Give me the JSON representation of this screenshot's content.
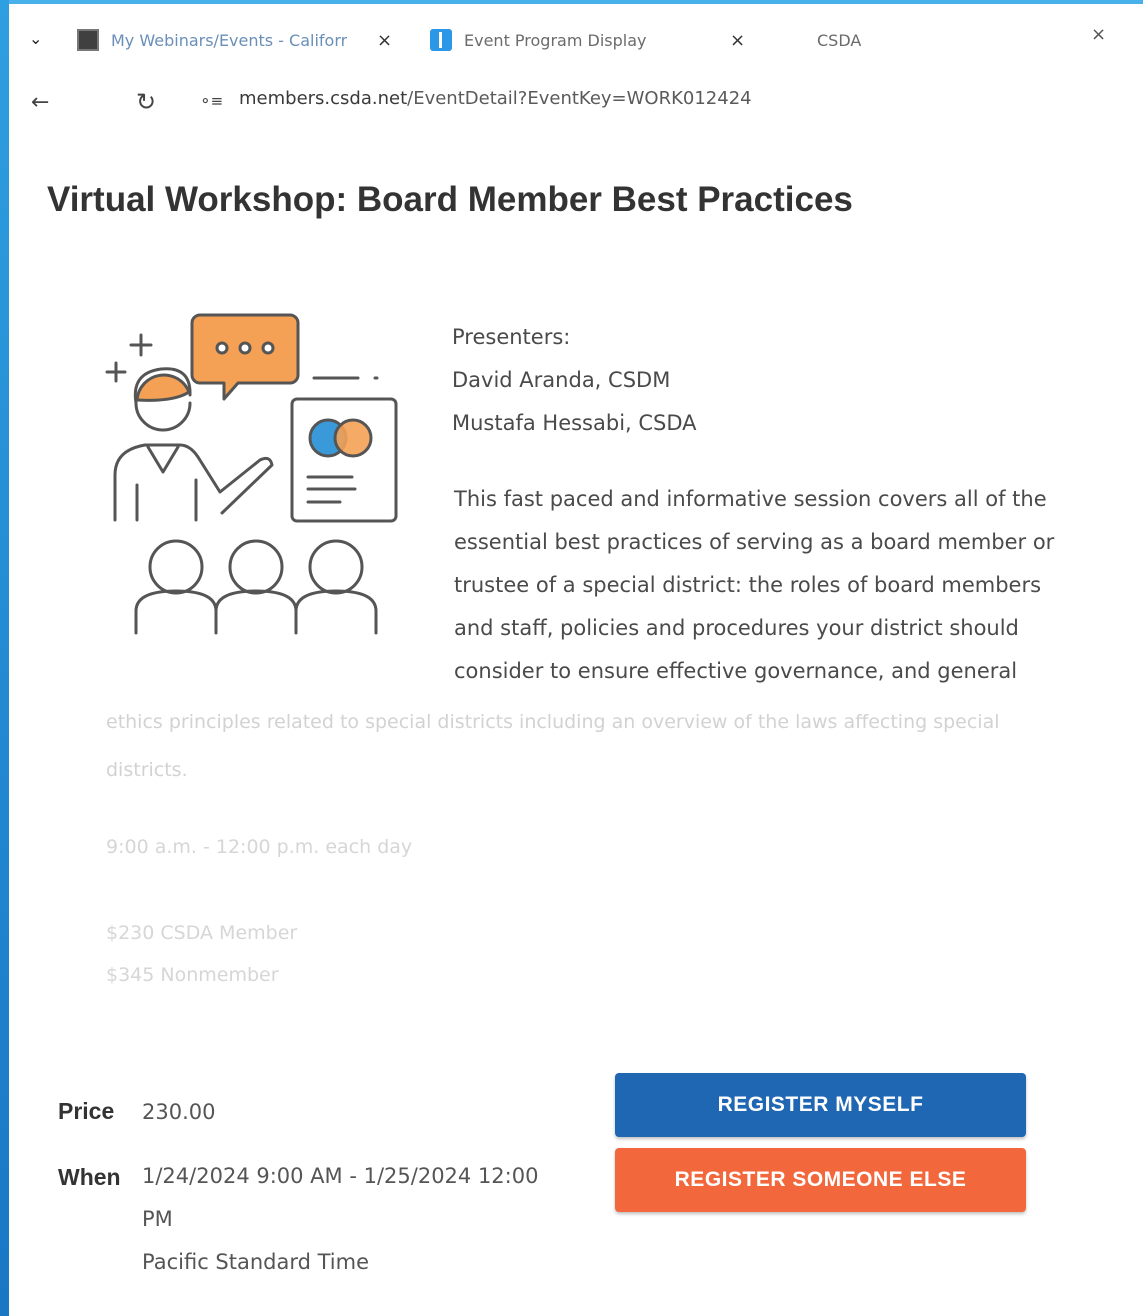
{
  "browser": {
    "tabs": [
      {
        "title": "My Webinars/Events - Califorr",
        "icon": "calendar-favicon"
      },
      {
        "title": "Event Program Display",
        "icon": "bar-favicon"
      },
      {
        "title": "CSDA",
        "icon": "none"
      }
    ],
    "tab_close_glyph": "×",
    "new_tab_glyph": "+",
    "menu_glyph": "⌄",
    "url_host": "members.csda.net",
    "url_path": "/EventDetail?EventKey=WORK012424"
  },
  "event": {
    "title": "Virtual Workshop: Board Member Best Practices",
    "presenters_heading": "Presenters:",
    "presenters": [
      "David Aranda, CSDM",
      "Mustafa Hessabi, CSDA"
    ],
    "description": "This fast paced and informative session covers all of the essential best practices of serving as a board member or trustee of a special district: the roles of board members and staff, policies and procedures your district should consider to ensure effective governance, and general",
    "description_faded": "ethics principles related to special districts including an overview of the laws affecting special districts.",
    "time_note": "9:00 a.m. - 12:00 p.m. each day",
    "pricing_lines": [
      "$230 CSDA Member",
      "$345 Nonmember"
    ]
  },
  "details": {
    "price_label": "Price",
    "price_value": "230.00",
    "when_label": "When",
    "when_line1": "1/24/2024 9:00 AM - 1/25/2024 12:00",
    "when_line2": "PM",
    "when_line3": "Pacific Standard Time"
  },
  "actions": {
    "register_myself": "REGISTER MYSELF",
    "register_someone_else": "REGISTER SOMEONE ELSE"
  },
  "colors": {
    "primary_button": "#1f67b3",
    "secondary_button": "#f2683c",
    "illustration_accent": "#f4a155",
    "illustration_blue": "#3a9ad9"
  }
}
